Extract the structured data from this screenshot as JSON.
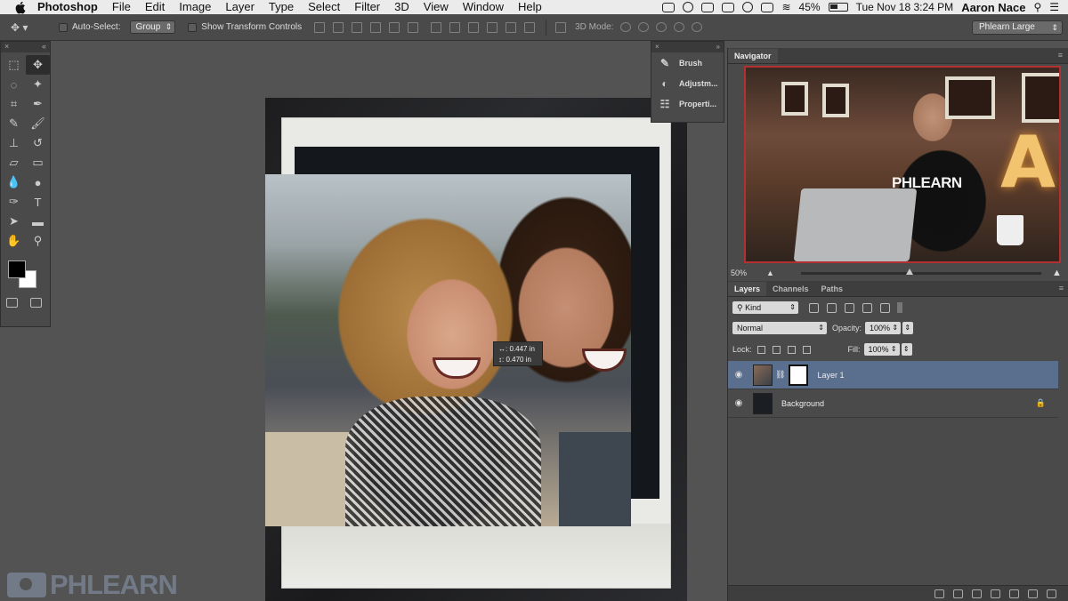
{
  "menubar": {
    "app_name": "Photoshop",
    "items": [
      "File",
      "Edit",
      "Image",
      "Layer",
      "Type",
      "Select",
      "Filter",
      "3D",
      "View",
      "Window",
      "Help"
    ],
    "battery": "45%",
    "clock": "Tue Nov 18  3:24 PM",
    "user": "Aaron Nace"
  },
  "options": {
    "auto_select_label": "Auto-Select:",
    "auto_select_value": "Group",
    "show_transform_label": "Show Transform Controls",
    "mode_3d_label": "3D Mode:",
    "workspace": "Phlearn Large"
  },
  "mini_panel": {
    "items": [
      {
        "label": "Brush",
        "icon": "brush-icon"
      },
      {
        "label": "Adjustm...",
        "icon": "adjustments-icon"
      },
      {
        "label": "Properti...",
        "icon": "properties-icon"
      }
    ]
  },
  "navigator": {
    "tab": "Navigator",
    "zoom": "50%",
    "preview_shirt_text": "PHLEARN",
    "preview_letter": "A"
  },
  "measure": {
    "width": "0.447 in",
    "height": "0.470 in"
  },
  "layers_panel": {
    "tabs": [
      "Layers",
      "Channels",
      "Paths"
    ],
    "filter_kind": "Kind",
    "blend_mode": "Normal",
    "opacity_label": "Opacity:",
    "opacity_value": "100%",
    "lock_label": "Lock:",
    "fill_label": "Fill:",
    "fill_value": "100%",
    "layers": [
      {
        "name": "Layer 1",
        "selected": true
      },
      {
        "name": "Background",
        "selected": false
      }
    ]
  },
  "watermark": "PHLEARN"
}
